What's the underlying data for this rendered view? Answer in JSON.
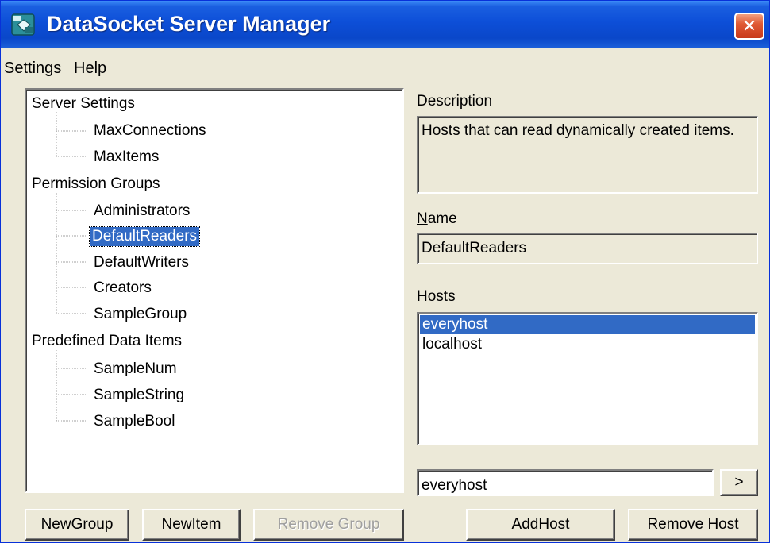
{
  "window": {
    "title": "DataSocket Server Manager"
  },
  "menu": {
    "items": [
      {
        "label": "Settings"
      },
      {
        "label": "Help"
      }
    ]
  },
  "tree": {
    "groups": [
      {
        "label": "Server Settings",
        "children": [
          "MaxConnections",
          "MaxItems"
        ]
      },
      {
        "label": "Permission Groups",
        "children": [
          "Administrators",
          "DefaultReaders",
          "DefaultWriters",
          "Creators",
          "SampleGroup"
        ]
      },
      {
        "label": "Predefined Data Items",
        "children": [
          "SampleNum",
          "SampleString",
          "SampleBool"
        ]
      }
    ],
    "selected": "DefaultReaders"
  },
  "description": {
    "label": "Description",
    "text": "Hosts that can read dynamically created items."
  },
  "name": {
    "label_first": "N",
    "label_rest": "ame",
    "value": "DefaultReaders"
  },
  "hosts": {
    "label": "Hosts",
    "items": [
      "everyhost",
      "localhost"
    ],
    "selected": "everyhost",
    "input_value": "everyhost",
    "arrow_label": ">"
  },
  "buttons": {
    "new_group": {
      "pre": "New ",
      "key": "G",
      "post": "roup"
    },
    "new_item": {
      "pre": "New ",
      "key": "I",
      "post": "tem"
    },
    "remove_group": {
      "label": "Remove Group",
      "enabled": false
    },
    "add_host": {
      "pre": "Add ",
      "key": "H",
      "post": "ost"
    },
    "remove_host": {
      "label": "Remove Host"
    }
  },
  "colors": {
    "title_bar": "#0a47c9",
    "selection": "#316ac5",
    "close_button": "#c8391a",
    "face": "#ece9d8"
  }
}
